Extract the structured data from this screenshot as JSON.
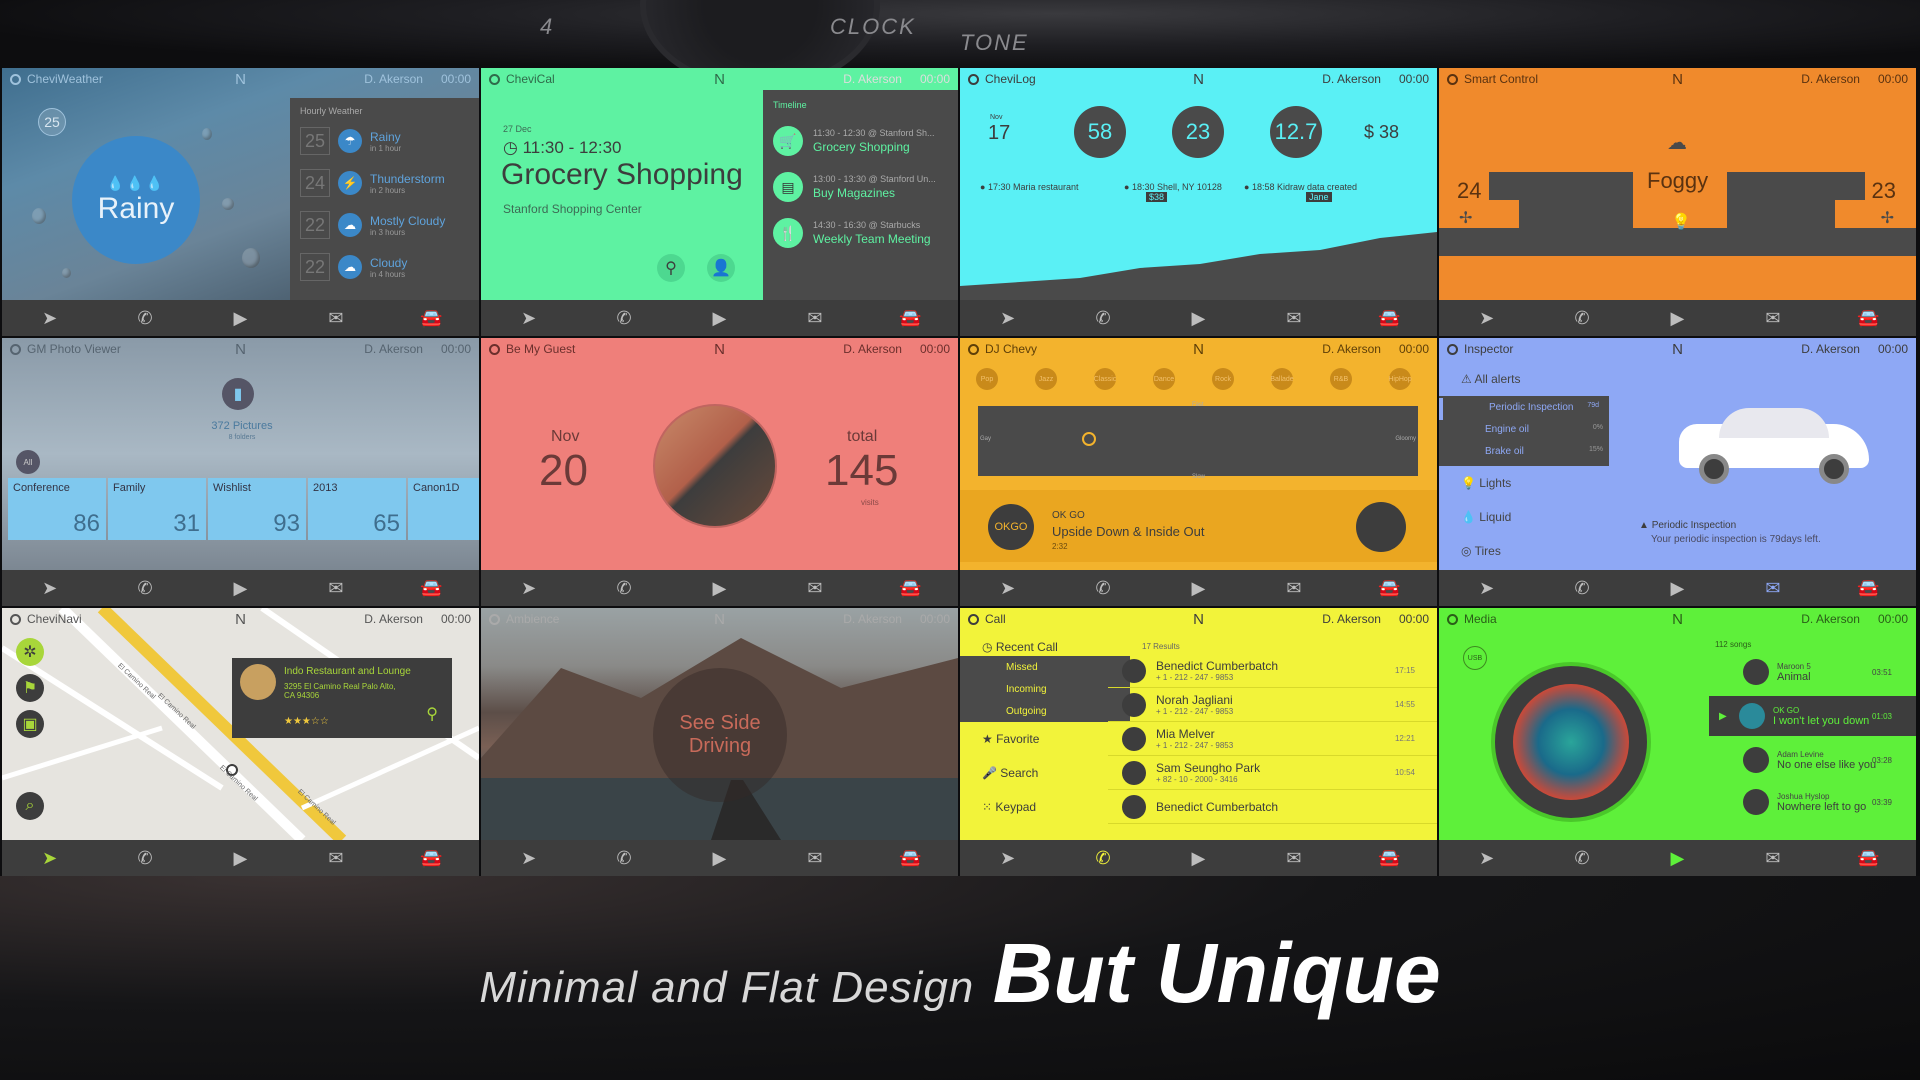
{
  "background": {
    "dial_labels": [
      "4",
      "CLOCK",
      "TONE"
    ]
  },
  "common": {
    "user": "D. Akerson",
    "time": "00:00",
    "compass": "N"
  },
  "weather": {
    "app": "CheviWeather",
    "temp": "25",
    "condition": "Rainy",
    "hourly_title": "Hourly Weather",
    "hours": [
      {
        "temp": "25",
        "label": "Rainy",
        "when": "in 1 hour"
      },
      {
        "temp": "24",
        "label": "Thunderstorm",
        "when": "in 2 hours"
      },
      {
        "temp": "22",
        "label": "Mostly Cloudy",
        "when": "in 3 hours"
      },
      {
        "temp": "22",
        "label": "Cloudy",
        "when": "in 4 hours"
      }
    ]
  },
  "calendar": {
    "app": "CheviCal",
    "date": "27 Dec",
    "time": "11:30 - 12:30",
    "title": "Grocery Shopping",
    "place": "Stanford Shopping Center",
    "timeline_title": "Timeline",
    "events": [
      {
        "when": "11:30 - 12:30  @ Stanford Sh...",
        "title": "Grocery Shopping",
        "icon": "cart-icon"
      },
      {
        "when": "13:00 - 13:30  @ Stanford Un...",
        "title": "Buy Magazines",
        "icon": "book-icon"
      },
      {
        "when": "14:30 - 16:30  @ Starbucks",
        "title": "Weekly Team Meeting",
        "icon": "cutlery-icon"
      }
    ]
  },
  "log": {
    "app": "CheviLog",
    "month": "Nov",
    "day": "17",
    "stats": [
      "58",
      "23",
      "12.7"
    ],
    "money": "$ 38",
    "entries": [
      {
        "time": "17:30",
        "text": "Maria restaurant"
      },
      {
        "time": "18:30",
        "text": "Shell, NY 10128",
        "tag": "$38"
      },
      {
        "time": "18:58",
        "text": "Kidraw data created",
        "tag": "Jane"
      }
    ]
  },
  "smart": {
    "app": "Smart Control",
    "left_temp": "24",
    "weather": "Foggy",
    "right_temp": "23"
  },
  "photo": {
    "app": "GM Photo Viewer",
    "count": "372 Pictures",
    "folders": "8 folders",
    "all": "All",
    "albums": [
      {
        "name": "Conference",
        "count": "86"
      },
      {
        "name": "Family",
        "count": "31"
      },
      {
        "name": "Wishlist",
        "count": "93"
      },
      {
        "name": "2013",
        "count": "65"
      },
      {
        "name": "Canon1D",
        "count": ""
      }
    ]
  },
  "guest": {
    "app": "Be My Guest",
    "month": "Nov",
    "day": "20",
    "total_label": "total",
    "total": "145",
    "visits": "visits"
  },
  "dj": {
    "app": "DJ Chevy",
    "genres": [
      "Pop",
      "Jazz",
      "Classic",
      "Dance",
      "Rock",
      "Ballade",
      "R&B",
      "HipHop"
    ],
    "axis": {
      "top": "Fast",
      "bottom": "Slow",
      "left": "Gay",
      "right": "Gloomy"
    },
    "artist": "OK GO",
    "song": "Upside Down & Inside Out",
    "duration": "2:32"
  },
  "inspector": {
    "app": "Inspector",
    "items": [
      "All alerts",
      "Periodic Inspection",
      "Engine oil",
      "Brake oil",
      "Lights",
      "Liquid",
      "Tires"
    ],
    "sub_values": [
      "79d",
      "0%",
      "15%"
    ],
    "alert_title": "Periodic Inspection",
    "alert_text": "Your periodic inspection is 79days left."
  },
  "navi": {
    "app": "CheviNavi",
    "place": "Indo Restaurant and Lounge",
    "address": "3295 El Camino Real Palo Alto, CA 94306",
    "stars": "★★★☆☆",
    "roads": [
      "El Camino Real",
      "El Camino Real",
      "El Camino Real",
      "El Camino Real"
    ]
  },
  "ambience": {
    "app": "Ambience",
    "overlay": "See Side Driving"
  },
  "call": {
    "app": "Call",
    "results": "17 Results",
    "menu": [
      "Recent Call",
      "Missed",
      "Incoming",
      "Outgoing",
      "Favorite",
      "Search",
      "Keypad"
    ],
    "contacts": [
      {
        "name": "Benedict Cumberbatch",
        "phone": "+ 1 - 212 - 247 - 9853",
        "time": "17:15"
      },
      {
        "name": "Norah Jagliani",
        "phone": "+ 1 - 212 - 247 - 9853",
        "time": "14:55"
      },
      {
        "name": "Mia Melver",
        "phone": "+ 1 - 212 - 247 - 9853",
        "time": "12:21"
      },
      {
        "name": "Sam Seungho Park",
        "phone": "+ 82 - 10 - 2000 - 3416",
        "time": "10:54"
      },
      {
        "name": "Benedict Cumberbatch",
        "phone": "",
        "time": ""
      }
    ]
  },
  "media": {
    "app": "Media",
    "usb": "USB",
    "songs": "112 songs",
    "tracks": [
      {
        "artist": "Maroon 5",
        "title": "Animal",
        "time": "03:51"
      },
      {
        "artist": "OK GO",
        "title": "I won't let you down",
        "time": "01:03"
      },
      {
        "artist": "Adam Levine",
        "title": "No one else like you",
        "time": "03:28"
      },
      {
        "artist": "Joshua Hyslop",
        "title": "Nowhere left to go",
        "time": "03:39"
      }
    ]
  },
  "caption": {
    "light": "Minimal and Flat Design",
    "bold": "But Unique"
  },
  "colors": {
    "weather": "#3b88c8",
    "calendar": "#5ef2a2",
    "log": "#5af0f5",
    "smart": "#f08a2c",
    "photo": "#7fc8ee",
    "guest": "#ef7f7a",
    "dj": "#f3b32d",
    "inspector": "#8ea8f5",
    "navi": "#a8d63a",
    "ambience": "#c86a5a",
    "call": "#f2f33a",
    "media": "#5ef03a"
  }
}
